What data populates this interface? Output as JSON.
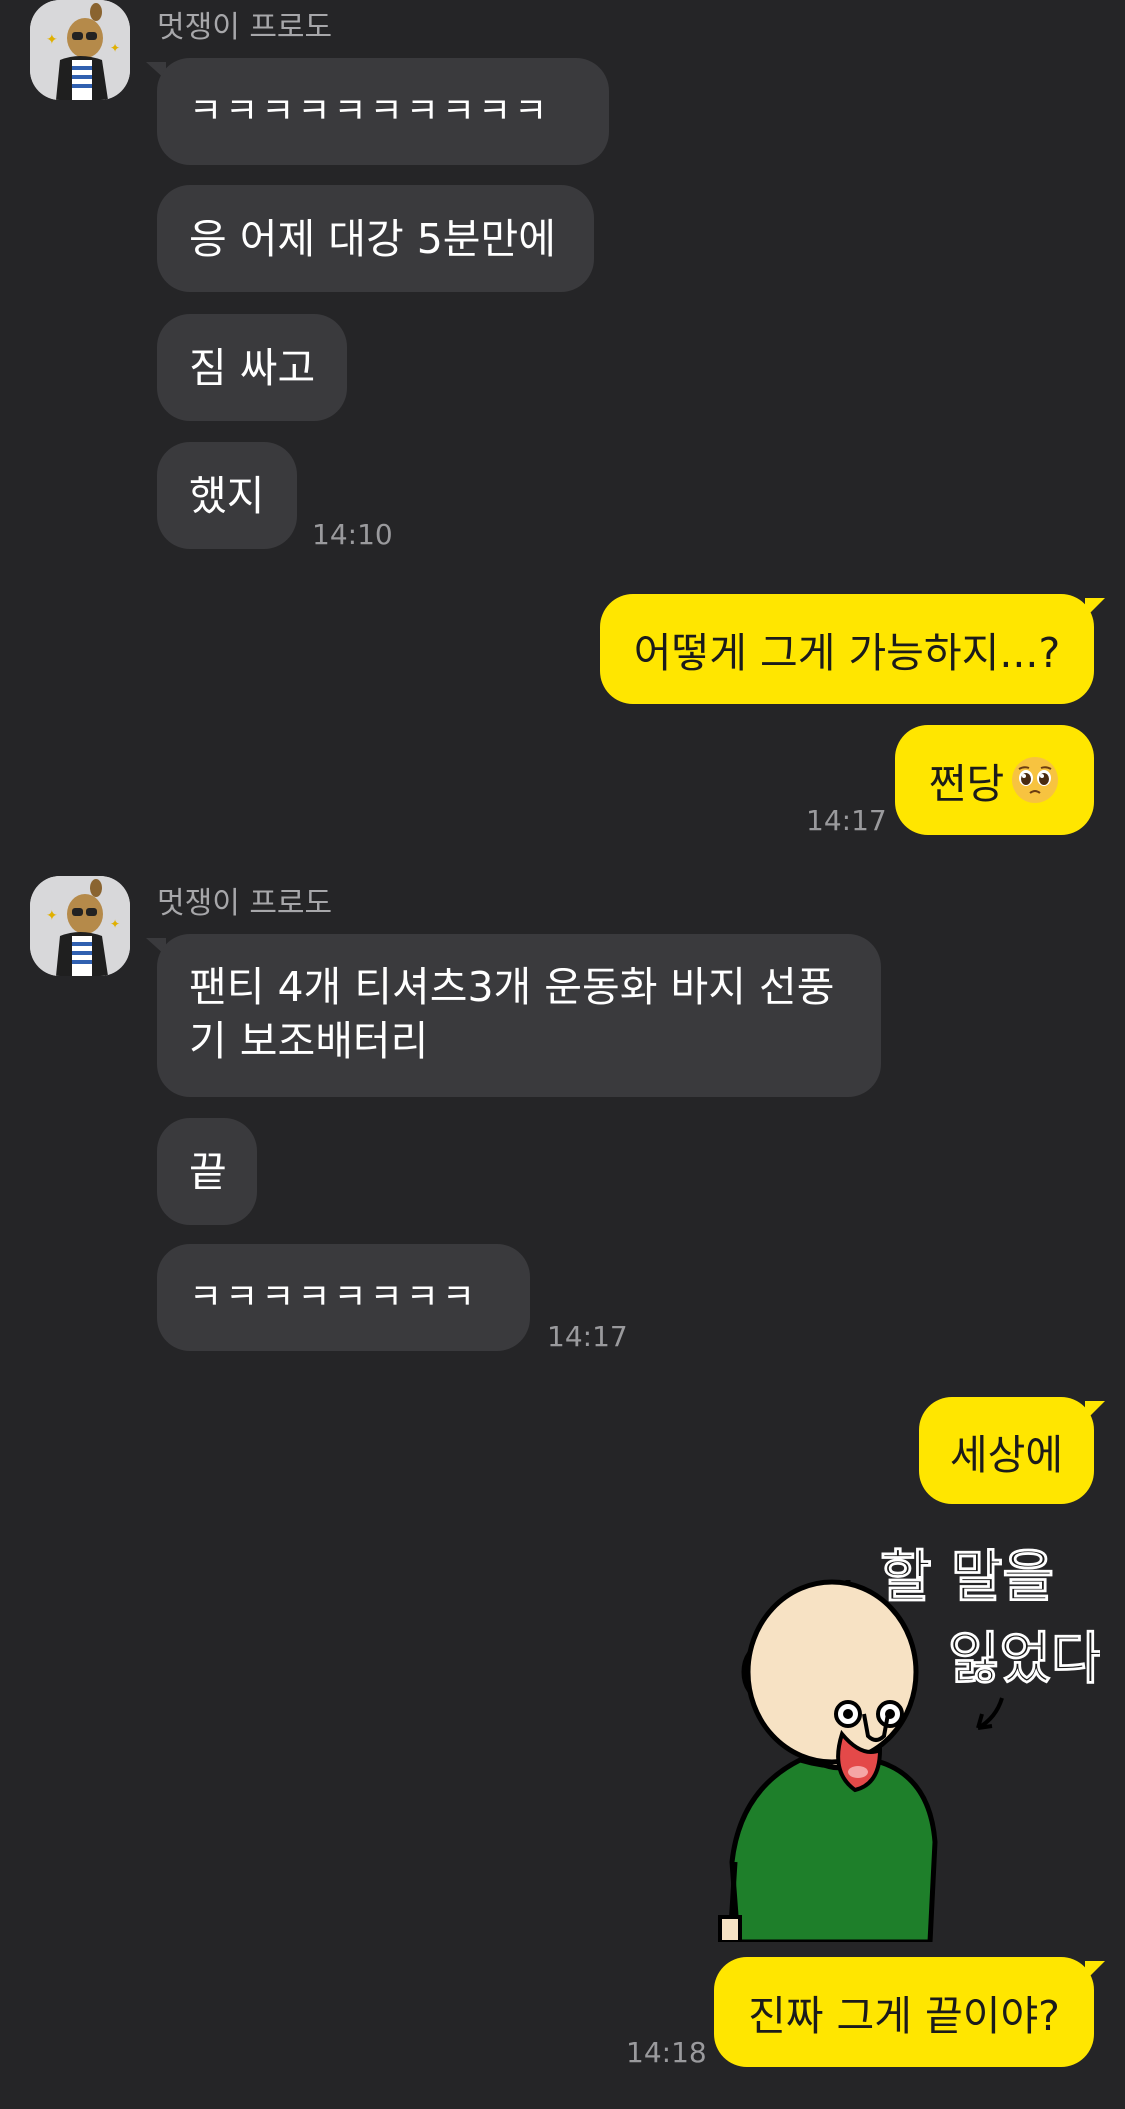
{
  "chat": {
    "sender_name": "멋쟁이 프로도",
    "group1": {
      "messages": [
        "ㅋㅋㅋㅋㅋㅋㅋㅋㅋㅋ",
        "응 어제 대강 5분만에",
        "짐 싸고",
        "했지"
      ],
      "time": "14:10"
    },
    "outgoing1": {
      "messages": [
        "어떻게 그게 가능하지...?",
        "쩐당"
      ],
      "emoji": "pleading-face-emoji",
      "time": "14:17"
    },
    "group2": {
      "messages": [
        "팬티 4개 티셔츠3개 운동화 바지 선풍기 보조배터리",
        "끝",
        "ㅋㅋㅋㅋㅋㅋㅋㅋ"
      ],
      "time": "14:17"
    },
    "outgoing2": {
      "messages": [
        "세상에"
      ],
      "sticker_text": "할 말을 잃었다.",
      "last_message": "진짜 그게 끝이야?",
      "time": "14:18"
    }
  },
  "colors": {
    "background": "#252527",
    "incoming_bubble": "#3a3a3d",
    "outgoing_bubble": "#ffe600",
    "timestamp": "#9a9a9d"
  }
}
